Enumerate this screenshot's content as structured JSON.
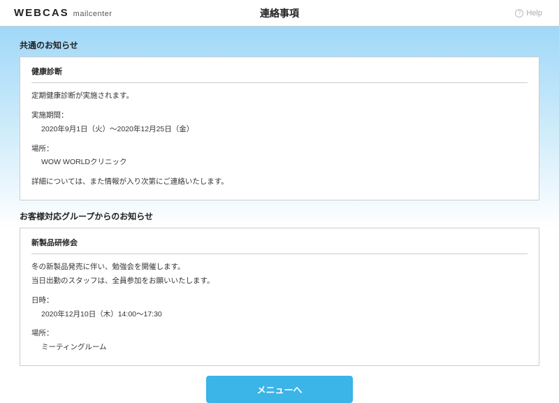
{
  "header": {
    "logo_main": "WEBCAS",
    "logo_sub": "mailcenter",
    "page_title": "連絡事項",
    "help_label": "Help"
  },
  "sections": {
    "common": {
      "heading": "共通のお知らせ",
      "notice": {
        "title": "健康診断",
        "lines": {
          "l1": "定期健康診断が実施されます。",
          "l2": "実施期間：",
          "l3": "2020年9月1日（火）～2020年12月25日（金）",
          "l4": "場所：",
          "l5": "WOW WORLDクリニック",
          "l6": "詳細については、また情報が入り次第にご連絡いたします。"
        }
      }
    },
    "group": {
      "heading": "お客様対応グループからのお知らせ",
      "notice": {
        "title": "新製品研修会",
        "lines": {
          "l1": "冬の新製品発売に伴い、勉強会を開催します。",
          "l2": "当日出勤のスタッフは、全員参加をお願いいたします。",
          "l3": "日時：",
          "l4": "2020年12月10日（木）14:00～17:30",
          "l5": "場所：",
          "l6": "ミーティングルーム"
        }
      }
    }
  },
  "menu_button": "メニューへ"
}
